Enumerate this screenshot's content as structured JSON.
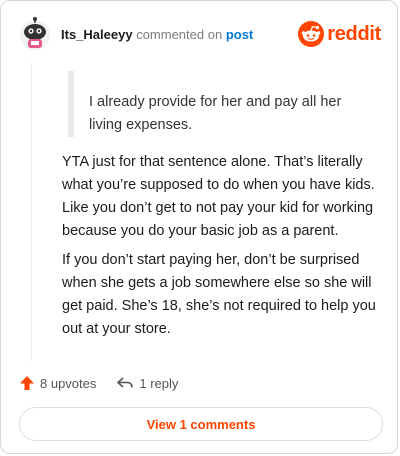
{
  "header": {
    "username": "Its_Haleeyy",
    "commented_text": "commented on",
    "post_link": "post",
    "brand": "reddit"
  },
  "comment": {
    "quote": "I already provide for her and pay all her living expenses.",
    "paragraphs": [
      "YTA just for that sentence alone. That’s literally what you’re supposed to do when you have kids. Like you don’t get to not pay your kid for working because you do your basic job as a parent.",
      "If you don’t start paying her, don’t be surprised when she gets a job somewhere else so she will get paid. She’s 18, she’s not required to help you out at your store."
    ]
  },
  "actions": {
    "upvotes": "8 upvotes",
    "reply": "1 reply"
  },
  "view_button": "View 1 comments",
  "colors": {
    "accent": "#ff4500",
    "link": "#0079d3"
  }
}
